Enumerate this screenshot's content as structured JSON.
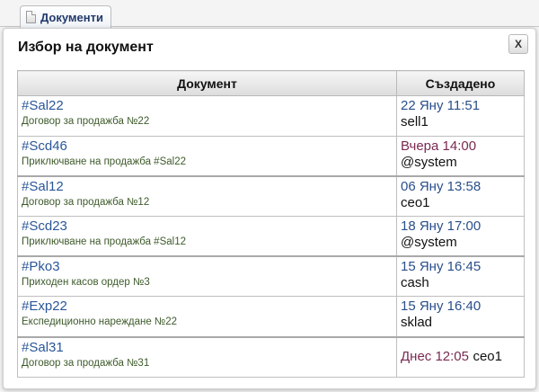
{
  "tab": {
    "label": "Документи"
  },
  "dialog": {
    "title": "Избор на документ",
    "close_label": "X"
  },
  "table": {
    "headers": {
      "document": "Документ",
      "created": "Създадено"
    },
    "rows": [
      {
        "id": "#Sal22",
        "desc": "Договор за продажба №22",
        "date": "22 Яну 11:51",
        "user": "sell1"
      },
      {
        "id": "#Scd46",
        "desc": "Приключване на продажба #Sal22",
        "date": "Вчера 14:00",
        "user": "@system"
      },
      {
        "id": "#Sal12",
        "desc": "Договор за продажба №12",
        "date": "06 Яну 13:58",
        "user": "ceo1"
      },
      {
        "id": "#Scd23",
        "desc": "Приключване на продажба #Sal12",
        "date": "18 Яну 17:00",
        "user": "@system"
      },
      {
        "id": "#Pko3",
        "desc": "Приходен касов ордер №3",
        "date": "15 Яну 16:45",
        "user": "cash"
      },
      {
        "id": "#Exp22",
        "desc": "Експедиционно нареждане №22",
        "date": "15 Яну 16:40",
        "user": "sklad"
      },
      {
        "id": "#Sal31",
        "desc": "Договор за продажба №31",
        "date": "Днес 12:05",
        "user": "ceo1"
      }
    ]
  },
  "colors": {
    "link": "#2a5699",
    "description": "#3d5a2a",
    "date_default": "#2a4f8a",
    "date_recent": "#7a2a52"
  }
}
